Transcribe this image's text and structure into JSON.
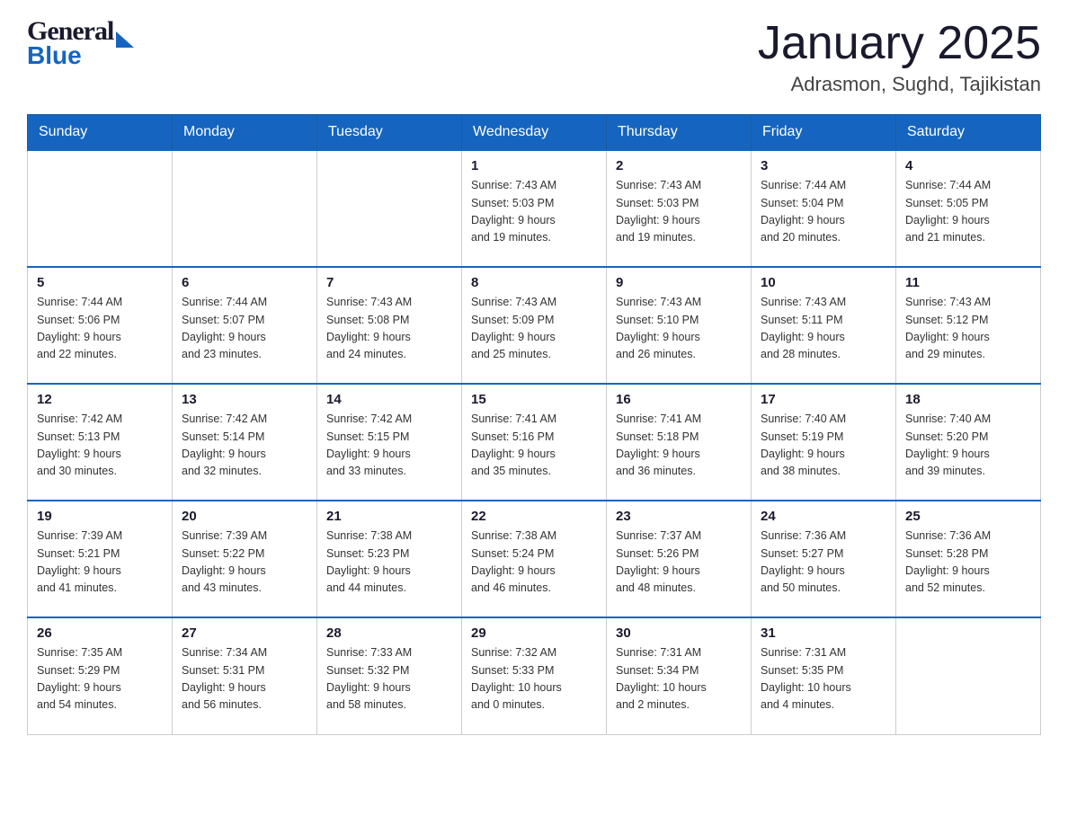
{
  "header": {
    "logo_line1": "General",
    "logo_line2": "Blue",
    "title": "January 2025",
    "subtitle": "Adrasmon, Sughd, Tajikistan"
  },
  "days_of_week": [
    "Sunday",
    "Monday",
    "Tuesday",
    "Wednesday",
    "Thursday",
    "Friday",
    "Saturday"
  ],
  "weeks": [
    [
      {
        "day": "",
        "info": ""
      },
      {
        "day": "",
        "info": ""
      },
      {
        "day": "",
        "info": ""
      },
      {
        "day": "1",
        "info": "Sunrise: 7:43 AM\nSunset: 5:03 PM\nDaylight: 9 hours\nand 19 minutes."
      },
      {
        "day": "2",
        "info": "Sunrise: 7:43 AM\nSunset: 5:03 PM\nDaylight: 9 hours\nand 19 minutes."
      },
      {
        "day": "3",
        "info": "Sunrise: 7:44 AM\nSunset: 5:04 PM\nDaylight: 9 hours\nand 20 minutes."
      },
      {
        "day": "4",
        "info": "Sunrise: 7:44 AM\nSunset: 5:05 PM\nDaylight: 9 hours\nand 21 minutes."
      }
    ],
    [
      {
        "day": "5",
        "info": "Sunrise: 7:44 AM\nSunset: 5:06 PM\nDaylight: 9 hours\nand 22 minutes."
      },
      {
        "day": "6",
        "info": "Sunrise: 7:44 AM\nSunset: 5:07 PM\nDaylight: 9 hours\nand 23 minutes."
      },
      {
        "day": "7",
        "info": "Sunrise: 7:43 AM\nSunset: 5:08 PM\nDaylight: 9 hours\nand 24 minutes."
      },
      {
        "day": "8",
        "info": "Sunrise: 7:43 AM\nSunset: 5:09 PM\nDaylight: 9 hours\nand 25 minutes."
      },
      {
        "day": "9",
        "info": "Sunrise: 7:43 AM\nSunset: 5:10 PM\nDaylight: 9 hours\nand 26 minutes."
      },
      {
        "day": "10",
        "info": "Sunrise: 7:43 AM\nSunset: 5:11 PM\nDaylight: 9 hours\nand 28 minutes."
      },
      {
        "day": "11",
        "info": "Sunrise: 7:43 AM\nSunset: 5:12 PM\nDaylight: 9 hours\nand 29 minutes."
      }
    ],
    [
      {
        "day": "12",
        "info": "Sunrise: 7:42 AM\nSunset: 5:13 PM\nDaylight: 9 hours\nand 30 minutes."
      },
      {
        "day": "13",
        "info": "Sunrise: 7:42 AM\nSunset: 5:14 PM\nDaylight: 9 hours\nand 32 minutes."
      },
      {
        "day": "14",
        "info": "Sunrise: 7:42 AM\nSunset: 5:15 PM\nDaylight: 9 hours\nand 33 minutes."
      },
      {
        "day": "15",
        "info": "Sunrise: 7:41 AM\nSunset: 5:16 PM\nDaylight: 9 hours\nand 35 minutes."
      },
      {
        "day": "16",
        "info": "Sunrise: 7:41 AM\nSunset: 5:18 PM\nDaylight: 9 hours\nand 36 minutes."
      },
      {
        "day": "17",
        "info": "Sunrise: 7:40 AM\nSunset: 5:19 PM\nDaylight: 9 hours\nand 38 minutes."
      },
      {
        "day": "18",
        "info": "Sunrise: 7:40 AM\nSunset: 5:20 PM\nDaylight: 9 hours\nand 39 minutes."
      }
    ],
    [
      {
        "day": "19",
        "info": "Sunrise: 7:39 AM\nSunset: 5:21 PM\nDaylight: 9 hours\nand 41 minutes."
      },
      {
        "day": "20",
        "info": "Sunrise: 7:39 AM\nSunset: 5:22 PM\nDaylight: 9 hours\nand 43 minutes."
      },
      {
        "day": "21",
        "info": "Sunrise: 7:38 AM\nSunset: 5:23 PM\nDaylight: 9 hours\nand 44 minutes."
      },
      {
        "day": "22",
        "info": "Sunrise: 7:38 AM\nSunset: 5:24 PM\nDaylight: 9 hours\nand 46 minutes."
      },
      {
        "day": "23",
        "info": "Sunrise: 7:37 AM\nSunset: 5:26 PM\nDaylight: 9 hours\nand 48 minutes."
      },
      {
        "day": "24",
        "info": "Sunrise: 7:36 AM\nSunset: 5:27 PM\nDaylight: 9 hours\nand 50 minutes."
      },
      {
        "day": "25",
        "info": "Sunrise: 7:36 AM\nSunset: 5:28 PM\nDaylight: 9 hours\nand 52 minutes."
      }
    ],
    [
      {
        "day": "26",
        "info": "Sunrise: 7:35 AM\nSunset: 5:29 PM\nDaylight: 9 hours\nand 54 minutes."
      },
      {
        "day": "27",
        "info": "Sunrise: 7:34 AM\nSunset: 5:31 PM\nDaylight: 9 hours\nand 56 minutes."
      },
      {
        "day": "28",
        "info": "Sunrise: 7:33 AM\nSunset: 5:32 PM\nDaylight: 9 hours\nand 58 minutes."
      },
      {
        "day": "29",
        "info": "Sunrise: 7:32 AM\nSunset: 5:33 PM\nDaylight: 10 hours\nand 0 minutes."
      },
      {
        "day": "30",
        "info": "Sunrise: 7:31 AM\nSunset: 5:34 PM\nDaylight: 10 hours\nand 2 minutes."
      },
      {
        "day": "31",
        "info": "Sunrise: 7:31 AM\nSunset: 5:35 PM\nDaylight: 10 hours\nand 4 minutes."
      },
      {
        "day": "",
        "info": ""
      }
    ]
  ]
}
